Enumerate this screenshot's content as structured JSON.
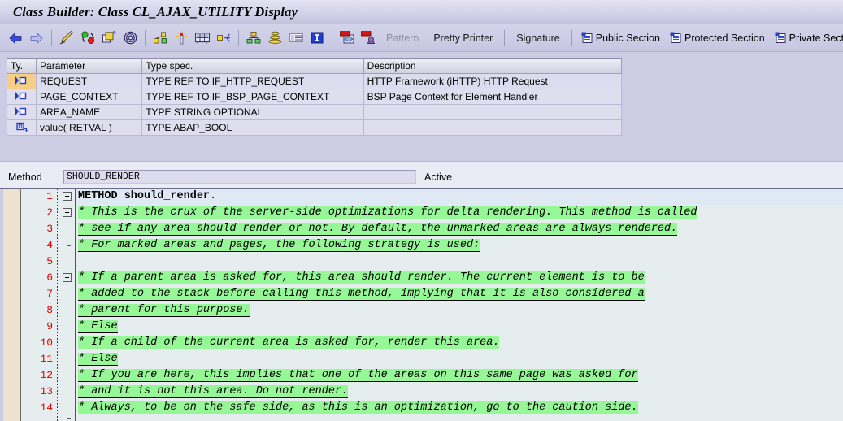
{
  "window": {
    "title": "Class Builder: Class CL_AJAX_UTILITY Display"
  },
  "toolbar": {
    "icons": [
      {
        "name": "back-arrow-icon",
        "label": "Back"
      },
      {
        "name": "forward-arrow-icon",
        "label": "Forward"
      },
      {
        "name": "pencil-display-change-icon",
        "label": "Display <-> Change"
      },
      {
        "name": "check-syntax-icon",
        "label": "Check"
      },
      {
        "name": "activate-icon",
        "label": "Activate"
      },
      {
        "name": "spiral-where-used-icon",
        "label": "Where-Used List"
      },
      {
        "name": "parameters-icon",
        "label": "Parameters"
      },
      {
        "name": "exceptions-wand-icon",
        "label": "Exceptions"
      },
      {
        "name": "source-code-icon",
        "label": "Source Code"
      },
      {
        "name": "redefine-arrows-icon",
        "label": "Redefine"
      },
      {
        "name": "class-hierarchy-icon",
        "label": "Class Hierarchy"
      },
      {
        "name": "inheritance-stack-icon",
        "label": "Inheritance"
      },
      {
        "name": "list-view-icon",
        "label": "List View"
      },
      {
        "name": "info-icon",
        "label": "Info"
      },
      {
        "name": "local-types-icon",
        "label": "Local Types"
      },
      {
        "name": "macros-icon",
        "label": "Macros"
      }
    ],
    "pattern_label": "Pattern",
    "pretty_printer_label": "Pretty Printer",
    "signature_label": "Signature",
    "public_section_label": "Public Section",
    "protected_section_label": "Protected Section",
    "private_section_label": "Private Section"
  },
  "params_table": {
    "columns": [
      "Ty.",
      "Parameter",
      "Type spec.",
      "Description"
    ],
    "rows": [
      {
        "ty_icon": "importing-parameter-icon",
        "ty_selected": true,
        "parameter": "REQUEST",
        "type_spec": "TYPE REF TO IF_HTTP_REQUEST",
        "description": "HTTP Framework (iHTTP) HTTP Request"
      },
      {
        "ty_icon": "importing-parameter-icon",
        "ty_selected": false,
        "parameter": "PAGE_CONTEXT",
        "type_spec": "TYPE REF TO IF_BSP_PAGE_CONTEXT",
        "description": "BSP Page Context for Element Handler"
      },
      {
        "ty_icon": "importing-parameter-icon",
        "ty_selected": false,
        "parameter": "AREA_NAME",
        "type_spec": "TYPE STRING OPTIONAL",
        "description": ""
      },
      {
        "ty_icon": "returning-parameter-icon",
        "ty_selected": false,
        "parameter": "value( RETVAL )",
        "type_spec": "TYPE ABAP_BOOL",
        "description": ""
      }
    ]
  },
  "method_bar": {
    "label": "Method",
    "value": "SHOULD_RENDER",
    "placeholder": "",
    "status": "Active"
  },
  "editor": {
    "lines": [
      {
        "num": "1",
        "fold": "collapse-box",
        "segments": [
          {
            "kind": "kw",
            "text": "METHOD should_render"
          },
          {
            "kind": "punct",
            "text": "."
          }
        ]
      },
      {
        "num": "2",
        "fold": "collapse-box",
        "segments": [
          {
            "kind": "cmt",
            "text": "* This is the crux of the server-side optimizations for delta rendering. This method is called"
          }
        ]
      },
      {
        "num": "3",
        "fold": "line",
        "segments": [
          {
            "kind": "cmt",
            "text": "* see if any area should render or not. By default, the unmarked areas are always rendered."
          }
        ]
      },
      {
        "num": "4",
        "fold": "end-tick",
        "segments": [
          {
            "kind": "cmt",
            "text": "* For marked areas and pages, the following strategy is used:"
          }
        ]
      },
      {
        "num": "5",
        "fold": "none",
        "segments": []
      },
      {
        "num": "6",
        "fold": "collapse-box",
        "segments": [
          {
            "kind": "cmt",
            "text": "*  If a parent area is asked for, this area should render. The current element is to be"
          }
        ]
      },
      {
        "num": "7",
        "fold": "line",
        "segments": [
          {
            "kind": "cmt",
            "text": "*  added to the stack before calling this method, implying that it is also considered a"
          }
        ]
      },
      {
        "num": "8",
        "fold": "line",
        "segments": [
          {
            "kind": "cmt",
            "text": "*  parent for this purpose."
          }
        ]
      },
      {
        "num": "9",
        "fold": "line",
        "segments": [
          {
            "kind": "cmt",
            "text": "*  Else"
          }
        ]
      },
      {
        "num": "10",
        "fold": "line",
        "segments": [
          {
            "kind": "cmt",
            "text": "*  If a child of the current area is asked for, render this area."
          }
        ]
      },
      {
        "num": "11",
        "fold": "line",
        "segments": [
          {
            "kind": "cmt",
            "text": "*  Else"
          }
        ]
      },
      {
        "num": "12",
        "fold": "line",
        "segments": [
          {
            "kind": "cmt",
            "text": "*  If you are here, this implies that one of the areas on this same page was asked for"
          }
        ]
      },
      {
        "num": "13",
        "fold": "line",
        "segments": [
          {
            "kind": "cmt",
            "text": "*  and it is not this area. Do not render."
          }
        ]
      },
      {
        "num": "14",
        "fold": "end-tick",
        "segments": [
          {
            "kind": "cmt",
            "text": "*  Always, to be on the safe side, as this is an optimization, go to the caution side."
          }
        ]
      }
    ]
  },
  "colors": {
    "title_bar": "#d6d6ec",
    "toolbar": "#cdcde6",
    "window_bg": "#ccccE4",
    "table_row": "#dedeef",
    "row_selected": "#f7cf84",
    "editor_bg": "#e6edee",
    "comment_highlight": "#96f796",
    "line_number": "#e00000",
    "keyword_bg": "#dfe9f3",
    "margin_tan": "#ece2cf"
  }
}
